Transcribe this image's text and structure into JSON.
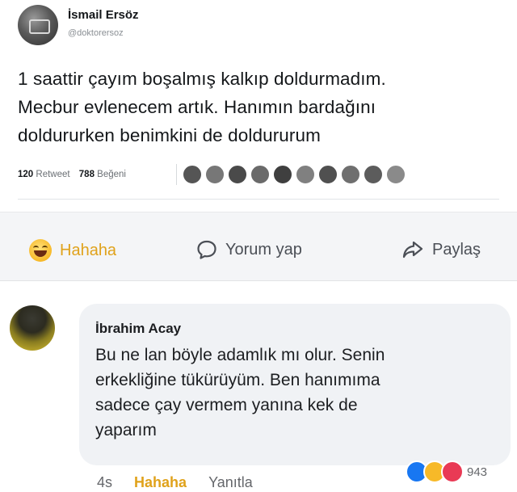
{
  "tweet": {
    "author_name": "İsmail Ersöz",
    "handle": "@doktorersoz",
    "text_lines": [
      "1 saattir çayım boşalmış kalkıp doldurmadım.",
      "Mecbur evlenecem artık. Hanımın bardağını",
      "doldururken benimkini de doldururum"
    ],
    "retweet_count": "120",
    "retweet_label": "Retweet",
    "like_count": "788",
    "like_label": "Beğeni"
  },
  "actions": {
    "haha_label": "Hahaha",
    "comment_label": "Yorum yap",
    "share_label": "Paylaş",
    "haha_color": "#e0a21b"
  },
  "comment": {
    "author_name": "İbrahim Acay",
    "text_lines": [
      "Bu ne lan böyle adamlık mı olur. Senin",
      "erkekliğine tükürüyüm. Ben hanımıma",
      "sadece çay vermem yanına kek de",
      "yaparım"
    ],
    "time": "4s",
    "haha_label": "Hahaha",
    "reply_label": "Yanıtla",
    "reaction_count": "943"
  }
}
